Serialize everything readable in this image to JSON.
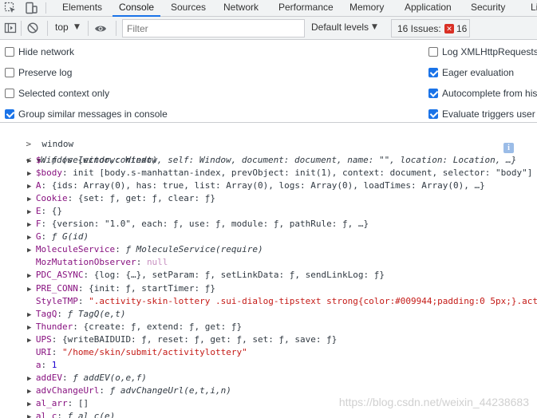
{
  "tabs": [
    "Elements",
    "Console",
    "Sources",
    "Network",
    "Performance",
    "Memory",
    "Application",
    "Security",
    "Li"
  ],
  "active_tab": "Console",
  "toolbar": {
    "context": "top",
    "filter_placeholder": "Filter",
    "levels": "Default levels",
    "issues_label": "16 Issues:",
    "issues_count": "16"
  },
  "settings": {
    "left": [
      {
        "label": "Hide network",
        "checked": false
      },
      {
        "label": "Preserve log",
        "checked": false
      },
      {
        "label": "Selected context only",
        "checked": false
      },
      {
        "label": "Group similar messages in console",
        "checked": true
      }
    ],
    "right": [
      {
        "label": "Log XMLHttpRequests",
        "checked": false
      },
      {
        "label": "Eager evaluation",
        "checked": true
      },
      {
        "label": "Autocomplete from his",
        "checked": true
      },
      {
        "label": "Evaluate triggers user a",
        "checked": true
      }
    ]
  },
  "console": {
    "input": "window",
    "result_head": "Window {window: Window, self: Window, document: document, name: \"\", location: Location, …}",
    "props": [
      {
        "key": "$",
        "value": "ƒ (selector,context)",
        "expandable": true
      },
      {
        "key": "$body",
        "value": "init [body.s-manhattan-index, prevObject: init(1), context: document, selector: \"body\"]",
        "expandable": true
      },
      {
        "key": "A",
        "value": "{ids: Array(0), has: true, list: Array(0), logs: Array(0), loadTimes: Array(0), …}",
        "expandable": true
      },
      {
        "key": "Cookie",
        "value": "{set: ƒ, get: ƒ, clear: ƒ}",
        "expandable": true
      },
      {
        "key": "E",
        "value": "{}",
        "expandable": true
      },
      {
        "key": "F",
        "value": "{version: \"1.0\", each: ƒ, use: ƒ, module: ƒ, pathRule: ƒ, …}",
        "expandable": true
      },
      {
        "key": "G",
        "value": "ƒ G(id)",
        "expandable": true
      },
      {
        "key": "MoleculeService",
        "value": "ƒ MoleculeService(require)",
        "expandable": true
      },
      {
        "key": "MozMutationObserver",
        "value": "null",
        "expandable": false
      },
      {
        "key": "PDC_ASYNC",
        "value": "{log: {…}, setParam: ƒ, setLinkData: ƒ, sendLinkLog: ƒ}",
        "expandable": true
      },
      {
        "key": "PRE_CONN",
        "value": "{init: ƒ, startTimer: ƒ}",
        "expandable": true
      },
      {
        "key": "StyleTMP",
        "value": "\".activity-skin-lottery .sui-dialog-tipstext strong{color:#009944;padding:0 5px;}.acti",
        "expandable": false
      },
      {
        "key": "TagQ",
        "value": "ƒ TagQ(e,t)",
        "expandable": true
      },
      {
        "key": "Thunder",
        "value": "{create: ƒ, extend: ƒ, get: ƒ}",
        "expandable": true
      },
      {
        "key": "UPS",
        "value": "{writeBAIDUID: ƒ, reset: ƒ, get: ƒ, set: ƒ, save: ƒ}",
        "expandable": true
      },
      {
        "key": "URI",
        "value": "\"/home/skin/submit/activitylottery\"",
        "expandable": false
      },
      {
        "key": "a",
        "value": "1",
        "expandable": false
      },
      {
        "key": "addEV",
        "value": "ƒ addEV(o,e,f)",
        "expandable": true
      },
      {
        "key": "advChangeUrl",
        "value": "ƒ advChangeUrl(e,t,i,n)",
        "expandable": true
      },
      {
        "key": "al_arr",
        "value": "[]",
        "expandable": true
      },
      {
        "key": "al_c",
        "value": "ƒ al_c(e)",
        "expandable": true
      }
    ]
  },
  "watermark": "https://blog.csdn.net/weixin_44238683"
}
